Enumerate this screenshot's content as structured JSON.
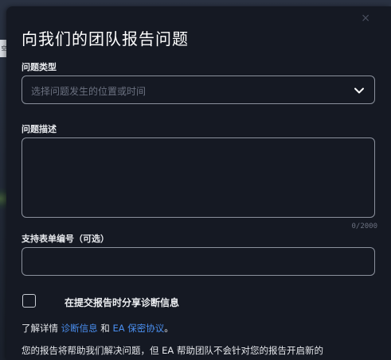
{
  "background": {
    "edge_tab_text": "空行"
  },
  "dialog": {
    "title": "向我们的团队报告问题",
    "close_symbol": "×",
    "issue_type": {
      "label": "问题类型",
      "placeholder": "选择问题发生的位置或时间"
    },
    "description": {
      "label": "问题描述",
      "value": "",
      "counter": "0/2000"
    },
    "ticket": {
      "label": "支持表单编号（可选）",
      "value": ""
    },
    "share_diagnostics": {
      "label": "在提交报告时分享诊断信息",
      "checked": false
    },
    "learn_more": {
      "prefix": "了解详情 ",
      "link1": "诊断信息",
      "middle": " 和 ",
      "link2": "EA 保密协议",
      "suffix": "。"
    },
    "note": "您的报告将帮助我们解决问题，但 EA 帮助团队不会针对您的报告开启新的"
  },
  "colors": {
    "link": "#4a8ff0",
    "modal_bg": "#151923",
    "border": "#8b919d"
  }
}
